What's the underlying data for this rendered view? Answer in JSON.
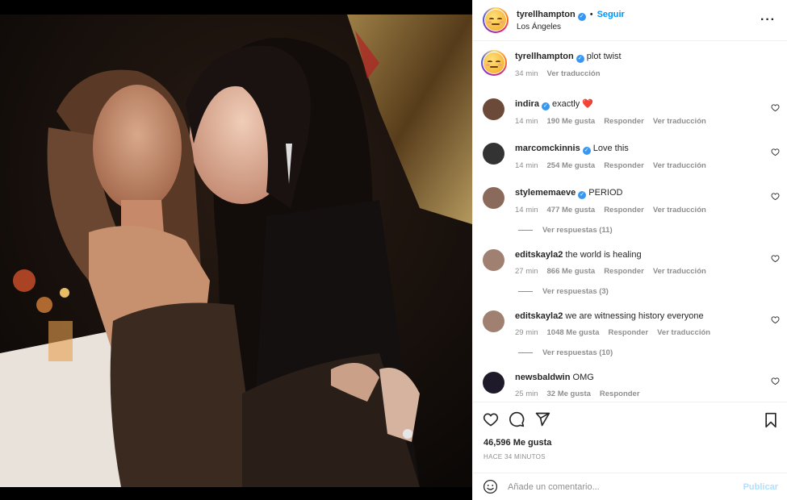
{
  "post": {
    "author": "tyrellhampton",
    "follow_label": "Seguir",
    "location": "Los Ángeles",
    "caption": "plot twist",
    "caption_time": "34 min",
    "caption_translate": "Ver traducción",
    "more_icon": "more-options-icon"
  },
  "comments": [
    {
      "user": "indira",
      "verified": true,
      "text": "exactly ❤️",
      "time": "14 min",
      "likes": "190 Me gusta",
      "reply": "Responder",
      "translate": "Ver traducción",
      "replies": ""
    },
    {
      "user": "marcomckinnis",
      "verified": true,
      "text": "Love this",
      "time": "14 min",
      "likes": "254 Me gusta",
      "reply": "Responder",
      "translate": "Ver traducción",
      "replies": ""
    },
    {
      "user": "stylememaeve",
      "verified": true,
      "text": "PERIOD",
      "time": "14 min",
      "likes": "477 Me gusta",
      "reply": "Responder",
      "translate": "Ver traducción",
      "replies": "Ver respuestas (11)"
    },
    {
      "user": "editskayla2",
      "verified": false,
      "text": "the world is healing",
      "time": "27 min",
      "likes": "866 Me gusta",
      "reply": "Responder",
      "translate": "Ver traducción",
      "replies": "Ver respuestas (3)"
    },
    {
      "user": "editskayla2",
      "verified": false,
      "text": "we are witnessing history everyone",
      "time": "29 min",
      "likes": "1048 Me gusta",
      "reply": "Responder",
      "translate": "Ver traducción",
      "replies": "Ver respuestas (10)"
    },
    {
      "user": "newsbaldwin",
      "verified": false,
      "text": "OMG",
      "time": "25 min",
      "likes": "32 Me gusta",
      "reply": "Responder",
      "translate": "",
      "replies": ""
    }
  ],
  "actions": {
    "likes": "46,596 Me gusta",
    "ago": "HACE 34 MINUTOS"
  },
  "composer": {
    "placeholder": "Añade un comentario...",
    "publish": "Publicar"
  },
  "colors": {
    "accent": "#0095f6",
    "verified": "#3897f0",
    "muted": "#8e8e8e"
  }
}
